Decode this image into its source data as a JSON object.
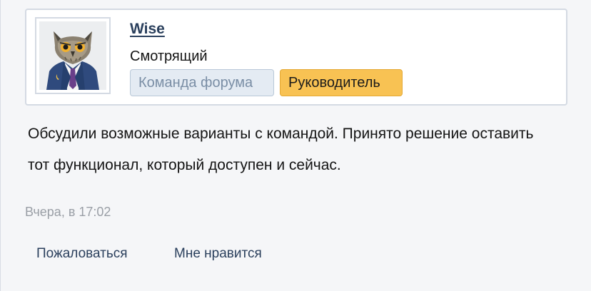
{
  "author": {
    "username": "Wise",
    "title": "Смотрящий",
    "avatar_icon": "owl-in-suit-avatar",
    "badges": [
      {
        "label": "Команда форума",
        "color": "#e4ebf3"
      },
      {
        "label": "Руководитель",
        "color": "#f8c253"
      }
    ]
  },
  "post": {
    "message": "Обсудили возможные варианты с командой. Принято решение оставить тот функционал, который доступен и сейчас.",
    "timestamp": "Вчера, в 17:02"
  },
  "actions": {
    "report_label": "Пожаловаться",
    "like_label": "Мне нравится"
  }
}
